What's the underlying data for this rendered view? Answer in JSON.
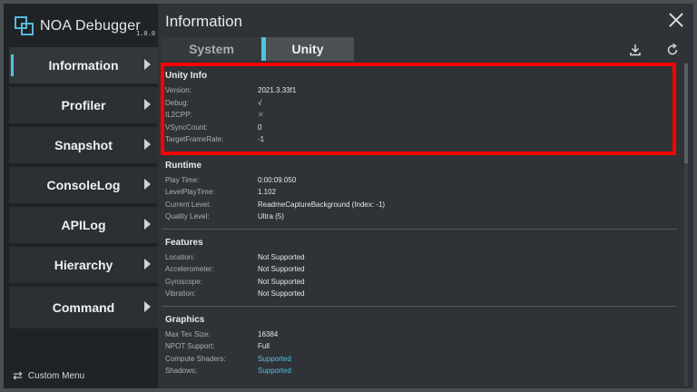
{
  "app": {
    "name": "NOA Debugger",
    "version": "1.0.0"
  },
  "sidebar": {
    "items": [
      {
        "label": "Information"
      },
      {
        "label": "Profiler"
      },
      {
        "label": "Snapshot"
      },
      {
        "label": "ConsoleLog"
      },
      {
        "label": "APILog"
      },
      {
        "label": "Hierarchy"
      },
      {
        "label": "Command"
      }
    ],
    "custom_menu_label": "Custom Menu"
  },
  "header": {
    "title": "Information"
  },
  "tabs": [
    {
      "label": "System"
    },
    {
      "label": "Unity"
    }
  ],
  "sections": {
    "unity_info": {
      "title": "Unity Info",
      "rows": [
        {
          "key": "Version:",
          "value": "2021.3.33f1"
        },
        {
          "key": "Debug:",
          "value": "√"
        },
        {
          "key": "IL2CPP:",
          "value": "✕"
        },
        {
          "key": "VSyncCount:",
          "value": "0"
        },
        {
          "key": "TargetFrameRate:",
          "value": "-1"
        }
      ]
    },
    "runtime": {
      "title": "Runtime",
      "rows": [
        {
          "key": "Play Time:",
          "value": "0:00:09.050"
        },
        {
          "key": "LevelPlayTime:",
          "value": "1.102"
        },
        {
          "key": "Current Level:",
          "value": "ReadmeCaptureBackground (Index: -1)"
        },
        {
          "key": "Quality Level:",
          "value": "Ultra (5)"
        }
      ]
    },
    "features": {
      "title": "Features",
      "rows": [
        {
          "key": "Location:",
          "value": "Not Supported"
        },
        {
          "key": "Accelerometer:",
          "value": "Not Supported"
        },
        {
          "key": "Gyroscope:",
          "value": "Not Supported"
        },
        {
          "key": "Vibration:",
          "value": "Not Supported"
        }
      ]
    },
    "graphics": {
      "title": "Graphics",
      "rows": [
        {
          "key": "Max Tex Size:",
          "value": "16384"
        },
        {
          "key": "NPOT Support:",
          "value": "Full"
        },
        {
          "key": "Compute Shaders:",
          "value": "Supported"
        },
        {
          "key": "Shadows:",
          "value": "Supported"
        }
      ]
    }
  },
  "colors": {
    "accent": "#4fc3e0",
    "highlight": "#ff0000"
  }
}
